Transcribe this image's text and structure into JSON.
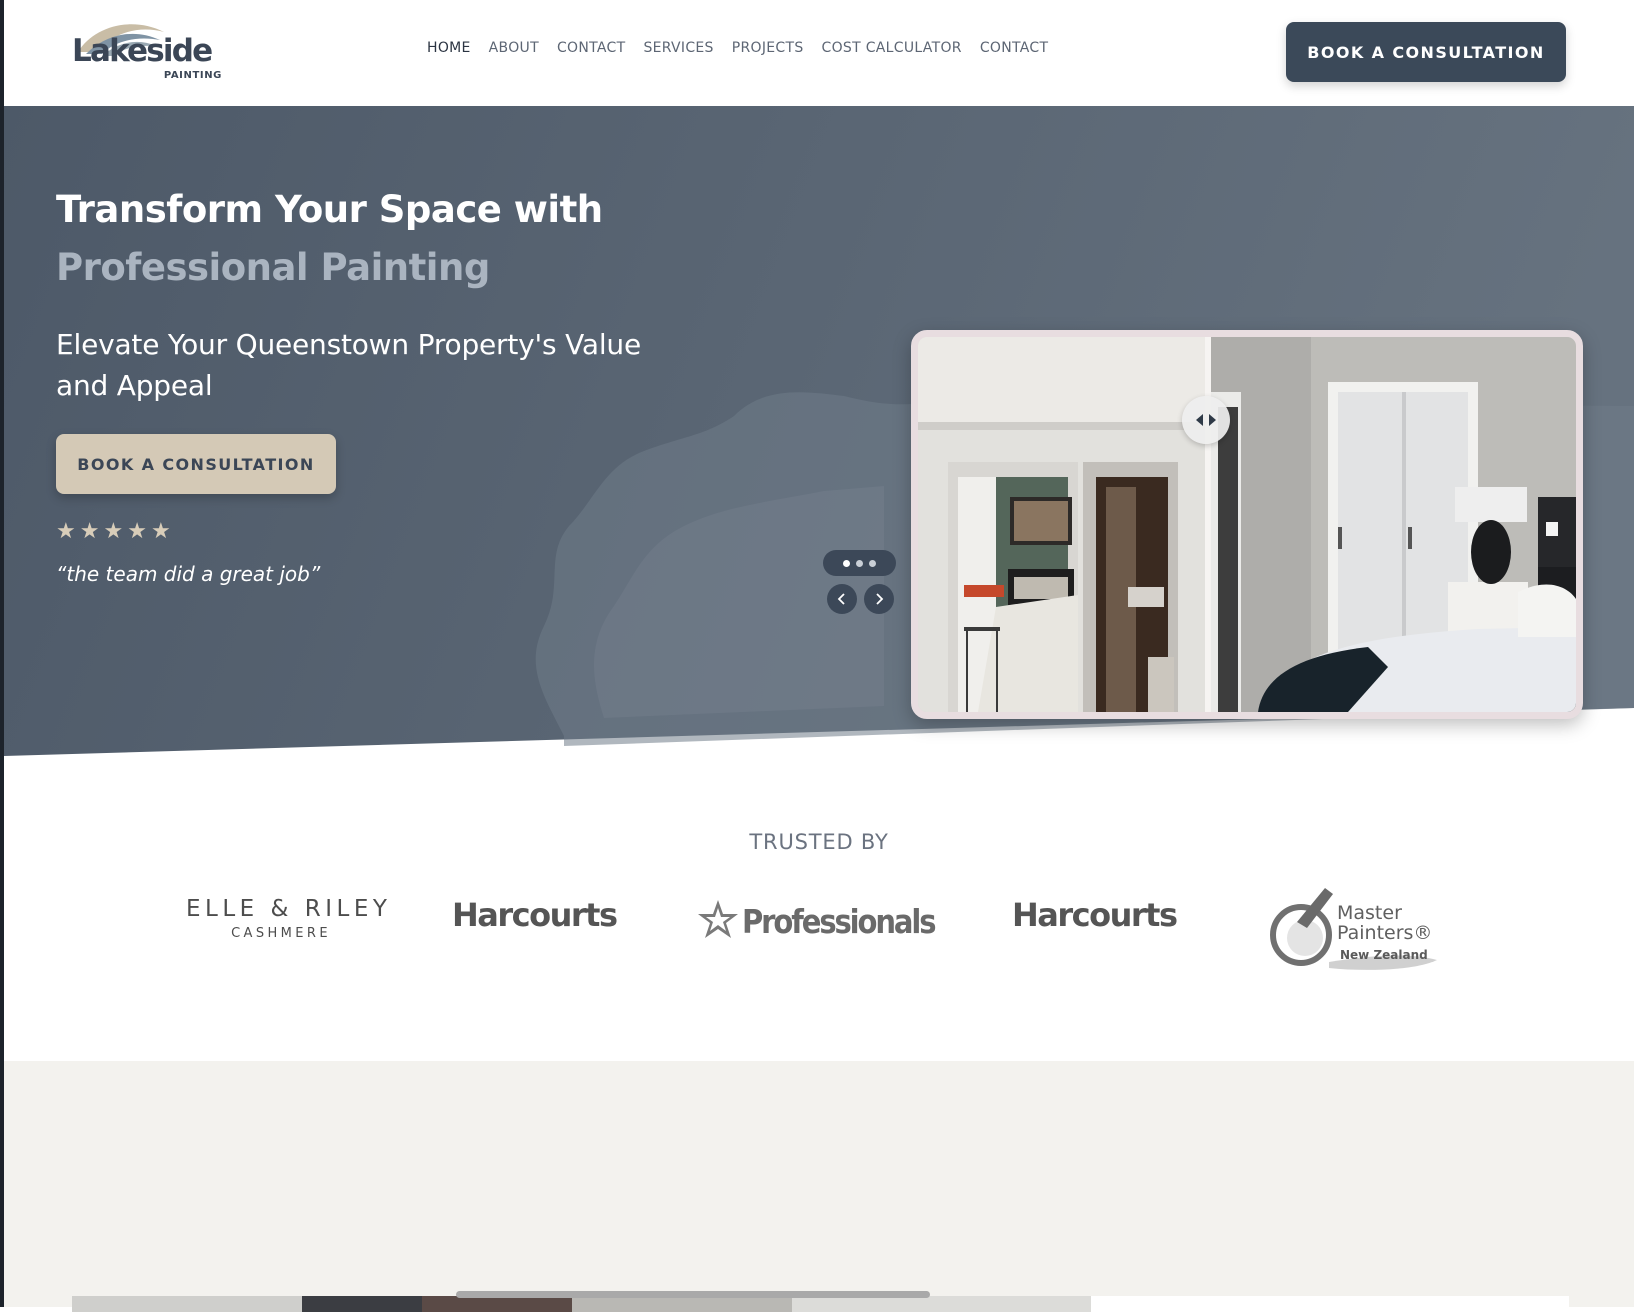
{
  "brand": {
    "name": "Lakeside",
    "tagline": "PAINTING",
    "colors": {
      "navy": "#3b4959",
      "sand": "#d4c9b6",
      "hero_bg": "#56626f",
      "muted_title": "#aab4c0",
      "cream_section": "#f3f2ee"
    }
  },
  "nav": {
    "items": [
      {
        "label": "HOME",
        "active": true
      },
      {
        "label": "ABOUT",
        "active": false
      },
      {
        "label": "CONTACT",
        "active": false
      },
      {
        "label": "SERVICES",
        "active": false
      },
      {
        "label": "PROJECTS",
        "active": false
      },
      {
        "label": "COST CALCULATOR",
        "active": false
      },
      {
        "label": "CONTACT",
        "active": false
      }
    ],
    "cta_label": "BOOK A CONSULTATION"
  },
  "hero": {
    "title_line1": "Transform Your Space with",
    "title_line2": "Professional Painting",
    "subtitle": "Elevate Your Queenstown Property's Value and Appeal",
    "cta_label": "BOOK A CONSULTATION",
    "rating": {
      "stars": 5,
      "max": 5
    },
    "quote": "“the team did a great job”",
    "slider": {
      "slides": 3,
      "active_slide": 1,
      "icons": [
        "chevron-left-icon",
        "chevron-right-icon",
        "drag-handle-icon"
      ]
    }
  },
  "trusted": {
    "title": "TRUSTED BY",
    "logos": {
      "elle_main": "ELLE & RILEY",
      "elle_sub": "CASHMERE",
      "harcourts_1": "Harcourts",
      "professionals": "Professionals",
      "harcourts_2": "Harcourts",
      "master_1": "Master",
      "master_2": "Painters®",
      "master_3": "New Zealand"
    }
  }
}
